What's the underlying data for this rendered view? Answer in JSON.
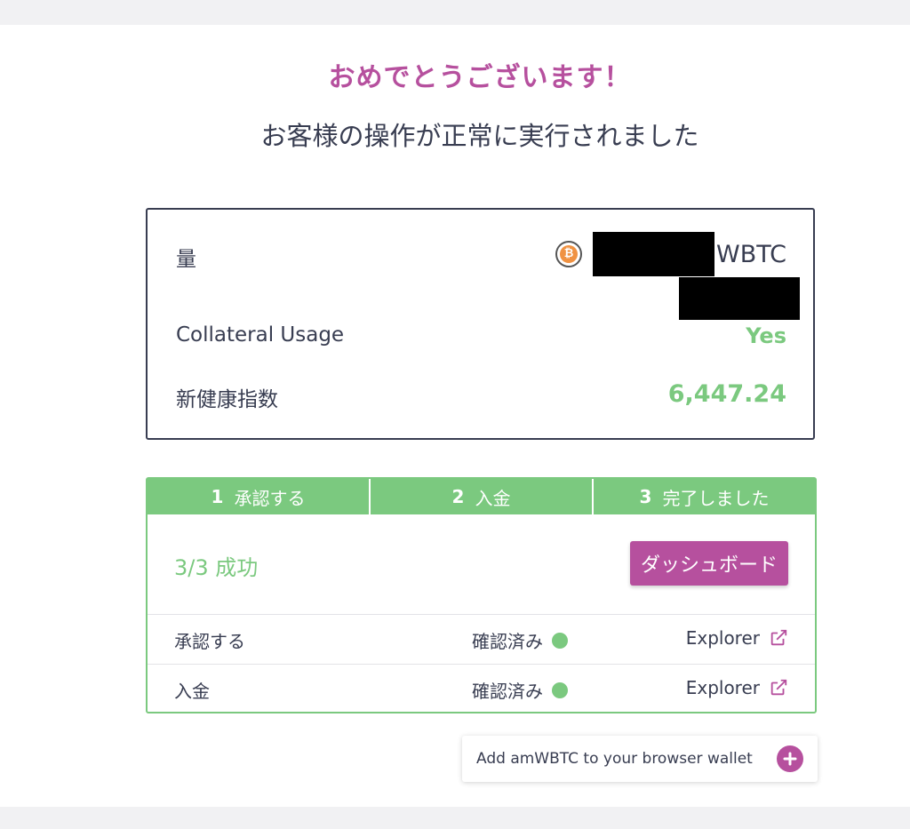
{
  "header": {
    "title": "おめでとうございます！",
    "subtitle": "お客様の操作が正常に実行されました"
  },
  "summary": {
    "amount_label": "量",
    "amount_symbol": "WBTC",
    "asset_icon": "bitcoin-icon",
    "collateral_label": "Collateral Usage",
    "collateral_value": "Yes",
    "health_label": "新健康指数",
    "health_value": "6,447.24"
  },
  "steps": [
    {
      "num": "1",
      "label": "承認する"
    },
    {
      "num": "2",
      "label": "入金"
    },
    {
      "num": "3",
      "label": "完了しました"
    }
  ],
  "result": {
    "status_text": "3/3 成功",
    "dashboard_label": "ダッシュボード"
  },
  "transactions": [
    {
      "label": "承認する",
      "status": "確認済み",
      "link": "Explorer"
    },
    {
      "label": "入金",
      "status": "確認済み",
      "link": "Explorer"
    }
  ],
  "wallet": {
    "label": "Add amWBTC to your browser wallet"
  },
  "colors": {
    "accent": "#b6509e",
    "success": "#7bc97f",
    "text": "#383d51"
  }
}
